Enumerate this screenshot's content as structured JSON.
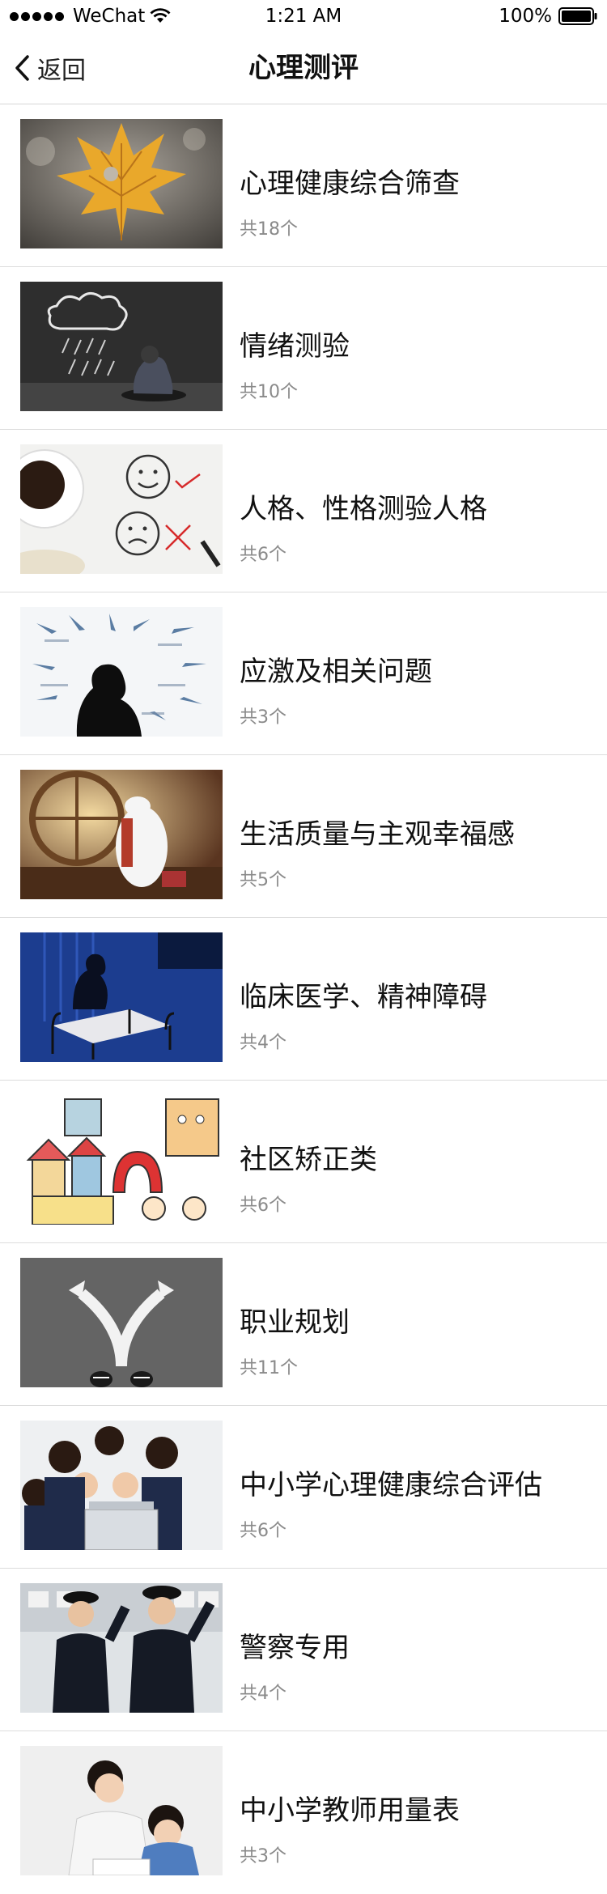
{
  "status_bar": {
    "carrier": "WeChat",
    "time": "1:21 AM",
    "battery": "100%"
  },
  "nav": {
    "back_label": "返回",
    "title": "心理测评"
  },
  "items": [
    {
      "title": "心理健康综合筛查",
      "count": "共18个",
      "image": "autumn-leaf-photo"
    },
    {
      "title": "情绪测验",
      "count": "共10个",
      "image": "sad-person-rain-cloud-photo"
    },
    {
      "title": "人格、性格测验人格",
      "count": "共6个",
      "image": "smiley-faces-coffee-photo"
    },
    {
      "title": "应激及相关问题",
      "count": "共3个",
      "image": "stressed-silhouette-arrows-photo"
    },
    {
      "title": "生活质量与主观幸福感",
      "count": "共5个",
      "image": "baymax-hug-photo"
    },
    {
      "title": "临床医学、精神障碍",
      "count": "共4个",
      "image": "hospital-bed-silhouette-photo"
    },
    {
      "title": "社区矫正类",
      "count": "共6个",
      "image": "community-correction-cartoon"
    },
    {
      "title": "职业规划",
      "count": "共11个",
      "image": "road-arrows-shoes-photo"
    },
    {
      "title": "中小学心理健康综合评估",
      "count": "共6个",
      "image": "students-laptop-photo"
    },
    {
      "title": "警察专用",
      "count": "共4个",
      "image": "police-salute-photo"
    },
    {
      "title": "中小学教师用量表",
      "count": "共3个",
      "image": "teacher-child-photo"
    }
  ]
}
